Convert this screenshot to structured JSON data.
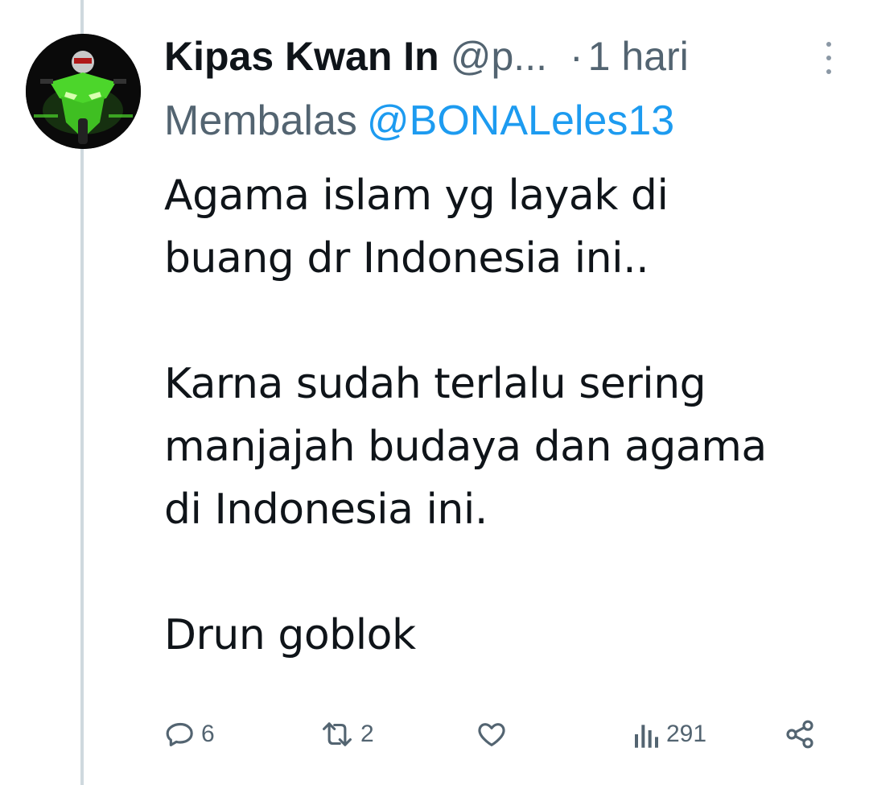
{
  "tweet": {
    "display_name": "Kipas Kwan In",
    "handle": "@p...",
    "separator": "·",
    "time": "1 hari",
    "reply_prefix": "Membalas",
    "reply_mention": "@BONALeles13",
    "text": "Agama islam yg layak di\nbuang dr Indonesia ini..\n\nKarna sudah terlalu sering\nmanjajah budaya dan agama\ndi Indonesia ini.\n\nDrun goblok",
    "avatar_icon": "motorcycle-avatar-icon",
    "more_icon": "more-vertical-icon"
  },
  "actions": {
    "reply": {
      "icon": "reply-icon",
      "count": "6"
    },
    "retweet": {
      "icon": "retweet-icon",
      "count": "2"
    },
    "like": {
      "icon": "heart-icon",
      "count": ""
    },
    "views": {
      "icon": "views-icon",
      "count": "291"
    },
    "share": {
      "icon": "share-icon"
    }
  },
  "colors": {
    "text": "#0f1419",
    "secondary": "#536471",
    "link": "#1d9bf0",
    "thread_line": "#cfd9de",
    "avatar_accent": "#4cd62b"
  }
}
